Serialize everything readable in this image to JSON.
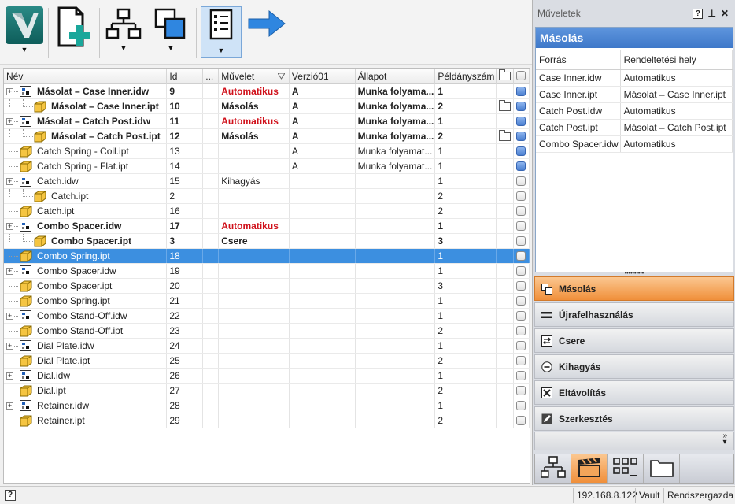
{
  "toolbar": {
    "buttons": [
      {
        "name": "vault-logo-button",
        "icon": "vault-logo-icon",
        "has_dropdown": true
      },
      {
        "name": "add-file-button",
        "icon": "add-file-icon",
        "has_dropdown": false
      },
      {
        "name": "structure-button",
        "icon": "hierarchy-icon",
        "has_dropdown": true
      },
      {
        "name": "copy-layout-button",
        "icon": "copy-squares-icon",
        "has_dropdown": true
      },
      {
        "name": "list-view-button",
        "icon": "list-view-icon",
        "has_dropdown": true,
        "active": true
      },
      {
        "name": "next-arrow-button",
        "icon": "arrow-right-icon",
        "has_dropdown": false
      }
    ]
  },
  "grid": {
    "columns": {
      "name": "Név",
      "id": "Id",
      "dots": "...",
      "operation": "Művelet",
      "version": "Verzió01",
      "state": "Állapot",
      "count": "Példányszám"
    },
    "rows": [
      {
        "name": "Másolat – Case Inner.idw",
        "id": "9",
        "op": "Automatikus",
        "op_red": true,
        "ver": "A",
        "state": "Munka folyama...",
        "count": "1",
        "bold": true,
        "level": 0,
        "icon": "drawing-icon",
        "expander": true,
        "folder": false,
        "check": "blue"
      },
      {
        "name": "Másolat – Case Inner.ipt",
        "id": "10",
        "op": "Másolás",
        "op_red": false,
        "ver": "A",
        "state": "Munka folyama...",
        "count": "2",
        "bold": true,
        "level": 1,
        "icon": "part-icon",
        "expander": false,
        "folder": true,
        "check": "blue"
      },
      {
        "name": "Másolat – Catch Post.idw",
        "id": "11",
        "op": "Automatikus",
        "op_red": true,
        "ver": "A",
        "state": "Munka folyama...",
        "count": "1",
        "bold": true,
        "level": 0,
        "icon": "drawing-icon",
        "expander": true,
        "folder": false,
        "check": "blue"
      },
      {
        "name": "Másolat – Catch Post.ipt",
        "id": "12",
        "op": "Másolás",
        "op_red": false,
        "ver": "A",
        "state": "Munka folyama...",
        "count": "2",
        "bold": true,
        "level": 1,
        "icon": "part-icon",
        "expander": false,
        "folder": true,
        "check": "blue"
      },
      {
        "name": "Catch Spring - Coil.ipt",
        "id": "13",
        "op": "",
        "op_red": false,
        "ver": "A",
        "state": "Munka folyamat...",
        "count": "1",
        "bold": false,
        "level": 0,
        "icon": "part-icon",
        "expander": false,
        "folder": false,
        "check": "blue"
      },
      {
        "name": "Catch Spring - Flat.ipt",
        "id": "14",
        "op": "",
        "op_red": false,
        "ver": "A",
        "state": "Munka folyamat...",
        "count": "1",
        "bold": false,
        "level": 0,
        "icon": "part-icon",
        "expander": false,
        "folder": false,
        "check": "blue"
      },
      {
        "name": "Catch.idw",
        "id": "15",
        "op": "Kihagyás",
        "op_red": false,
        "ver": "",
        "state": "",
        "count": "1",
        "bold": false,
        "level": 0,
        "icon": "drawing-icon",
        "expander": true,
        "folder": false,
        "check": "gray"
      },
      {
        "name": "Catch.ipt",
        "id": "2",
        "op": "",
        "op_red": false,
        "ver": "",
        "state": "",
        "count": "2",
        "bold": false,
        "level": 1,
        "icon": "part-icon",
        "expander": false,
        "folder": false,
        "check": "gray"
      },
      {
        "name": "Catch.ipt",
        "id": "16",
        "op": "",
        "op_red": false,
        "ver": "",
        "state": "",
        "count": "2",
        "bold": false,
        "level": 0,
        "icon": "part-icon",
        "expander": false,
        "folder": false,
        "check": "gray"
      },
      {
        "name": "Combo Spacer.idw",
        "id": "17",
        "op": "Automatikus",
        "op_red": true,
        "ver": "",
        "state": "",
        "count": "1",
        "bold": true,
        "level": 0,
        "icon": "drawing-icon",
        "expander": true,
        "folder": false,
        "check": "gray"
      },
      {
        "name": "Combo Spacer.ipt",
        "id": "3",
        "op": "Csere",
        "op_red": false,
        "ver": "",
        "state": "",
        "count": "3",
        "bold": true,
        "level": 1,
        "icon": "part-icon",
        "expander": false,
        "folder": false,
        "check": "gray"
      },
      {
        "name": "Combo Spring.ipt",
        "id": "18",
        "op": "",
        "op_red": false,
        "ver": "",
        "state": "",
        "count": "1",
        "bold": false,
        "level": 0,
        "icon": "part-icon",
        "expander": false,
        "folder": false,
        "check": "gray",
        "selected": true
      },
      {
        "name": "Combo Spacer.idw",
        "id": "19",
        "op": "",
        "op_red": false,
        "ver": "",
        "state": "",
        "count": "1",
        "bold": false,
        "level": 0,
        "icon": "drawing-icon",
        "expander": true,
        "folder": false,
        "check": "gray"
      },
      {
        "name": "Combo Spacer.ipt",
        "id": "20",
        "op": "",
        "op_red": false,
        "ver": "",
        "state": "",
        "count": "3",
        "bold": false,
        "level": 0,
        "icon": "part-icon",
        "expander": false,
        "folder": false,
        "check": "gray"
      },
      {
        "name": "Combo Spring.ipt",
        "id": "21",
        "op": "",
        "op_red": false,
        "ver": "",
        "state": "",
        "count": "1",
        "bold": false,
        "level": 0,
        "icon": "part-icon",
        "expander": false,
        "folder": false,
        "check": "gray"
      },
      {
        "name": "Combo Stand-Off.idw",
        "id": "22",
        "op": "",
        "op_red": false,
        "ver": "",
        "state": "",
        "count": "1",
        "bold": false,
        "level": 0,
        "icon": "drawing-icon",
        "expander": true,
        "folder": false,
        "check": "gray"
      },
      {
        "name": "Combo Stand-Off.ipt",
        "id": "23",
        "op": "",
        "op_red": false,
        "ver": "",
        "state": "",
        "count": "2",
        "bold": false,
        "level": 0,
        "icon": "part-icon",
        "expander": false,
        "folder": false,
        "check": "gray"
      },
      {
        "name": "Dial Plate.idw",
        "id": "24",
        "op": "",
        "op_red": false,
        "ver": "",
        "state": "",
        "count": "1",
        "bold": false,
        "level": 0,
        "icon": "drawing-icon",
        "expander": true,
        "folder": false,
        "check": "gray"
      },
      {
        "name": "Dial Plate.ipt",
        "id": "25",
        "op": "",
        "op_red": false,
        "ver": "",
        "state": "",
        "count": "2",
        "bold": false,
        "level": 0,
        "icon": "part-icon",
        "expander": false,
        "folder": false,
        "check": "gray"
      },
      {
        "name": "Dial.idw",
        "id": "26",
        "op": "",
        "op_red": false,
        "ver": "",
        "state": "",
        "count": "1",
        "bold": false,
        "level": 0,
        "icon": "drawing-icon",
        "expander": true,
        "folder": false,
        "check": "gray"
      },
      {
        "name": "Dial.ipt",
        "id": "27",
        "op": "",
        "op_red": false,
        "ver": "",
        "state": "",
        "count": "2",
        "bold": false,
        "level": 0,
        "icon": "part-icon",
        "expander": false,
        "folder": false,
        "check": "gray"
      },
      {
        "name": "Retainer.idw",
        "id": "28",
        "op": "",
        "op_red": false,
        "ver": "",
        "state": "",
        "count": "1",
        "bold": false,
        "level": 0,
        "icon": "drawing-icon",
        "expander": true,
        "folder": false,
        "check": "gray"
      },
      {
        "name": "Retainer.ipt",
        "id": "29",
        "op": "",
        "op_red": false,
        "ver": "",
        "state": "",
        "count": "2",
        "bold": false,
        "level": 0,
        "icon": "part-icon",
        "expander": false,
        "folder": false,
        "check": "gray"
      }
    ]
  },
  "panel": {
    "title": "Műveletek",
    "help": "?",
    "pin": "⊥",
    "close": "✕",
    "section_title": "Másolás",
    "table_headers": {
      "source": "Forrás",
      "target": "Rendeltetési hely"
    },
    "table_rows": [
      {
        "source": "Case Inner.idw",
        "target": "Automatikus"
      },
      {
        "source": "Case Inner.ipt",
        "target": "Másolat – Case Inner.ipt"
      },
      {
        "source": "Catch Post.idw",
        "target": "Automatikus"
      },
      {
        "source": "Catch Post.ipt",
        "target": "Másolat – Catch Post.ipt"
      },
      {
        "source": "Combo Spacer.idw",
        "target": "Automatikus"
      }
    ],
    "operations": [
      {
        "label": "Másolás",
        "icon": "copy-icon",
        "active": true
      },
      {
        "label": "Újrafelhasználás",
        "icon": "reuse-icon",
        "active": false
      },
      {
        "label": "Csere",
        "icon": "replace-icon",
        "active": false
      },
      {
        "label": "Kihagyás",
        "icon": "skip-icon",
        "active": false
      },
      {
        "label": "Eltávolítás",
        "icon": "remove-icon",
        "active": false
      },
      {
        "label": "Szerkesztés",
        "icon": "edit-icon",
        "active": false
      }
    ],
    "nav": [
      {
        "icon": "hierarchy-icon",
        "active": false
      },
      {
        "icon": "clapperboard-icon",
        "active": true
      },
      {
        "icon": "grid-list-icon",
        "active": false
      },
      {
        "icon": "folder-icon",
        "active": false
      }
    ]
  },
  "status": {
    "help": "?",
    "ip": "192.168.8.122",
    "vault": "Vault",
    "user": "Rendszergazda"
  },
  "colors": {
    "selection": "#3c8fe0",
    "accent_orange": "#f08f3a",
    "auto_red": "#d0111b",
    "panel_header": "#3e78c9"
  }
}
